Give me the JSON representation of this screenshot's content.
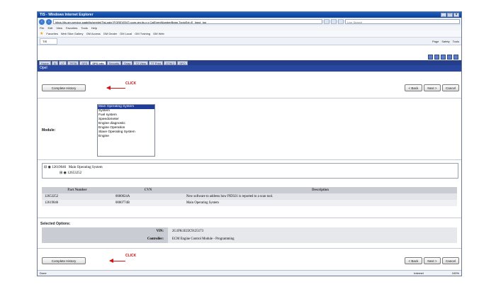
{
  "browser": {
    "title": "TIS - Windows Internet Explorer",
    "address": "https://tis.gm.service.saab/tis/servlet/TisLogin?FOREVENT=com.gm.tis.x.x.CalEventNumberBean.TopicExt=E_Input_top",
    "search_placeholder": "Live Search",
    "menu": [
      "File",
      "Edit",
      "View",
      "Favorites",
      "Tools",
      "Help"
    ],
    "favorites_label": "Favorites",
    "favorites_links": [
      "Web Slice Gallery",
      "GM Access",
      "GM Dealer",
      "GM Local",
      "GM Training",
      "GM Web"
    ],
    "tab_label": "TIS",
    "tools": [
      "Page",
      "Safety",
      "Tools"
    ],
    "status_left": "Done",
    "status_zone": "Internet",
    "zoom": "100%"
  },
  "app": {
    "nav_tabs": [
      "Home",
      "SI",
      "LT",
      "TRTB",
      "SPS",
      "SPS Info",
      "Security",
      "Snap",
      "T2 View",
      "TT Print",
      "GTM 2",
      "SPO"
    ],
    "active_tab": "SPS Info",
    "vehicle": "Opel",
    "complete_history_label": "Complete History",
    "click_label": "CLICK",
    "back_label": "< Back",
    "next_label": "Next >",
    "cancel_label": "Cancel",
    "module_label": "Module:",
    "modules": [
      "Main Operating System",
      "System",
      "Fuel system",
      "Speedometer",
      "Engine diagnostic",
      "Engine Operation",
      "Slave Operating System",
      "Engine"
    ],
    "selected_module": "Main Operating System",
    "tree": {
      "root_number": "12619046",
      "root_label": "Main Operating System",
      "child_number": "12653252"
    },
    "table": {
      "headers": [
        "Part Number",
        "CVN",
        "Description"
      ],
      "rows": [
        [
          "12653252",
          "0000024A",
          "New software to address how PID321 is reported to a scan tool."
        ],
        [
          "12619046",
          "0000774B",
          "Main Operating System"
        ]
      ]
    },
    "selected_options_label": "Selected Options:",
    "options": [
      {
        "key": "VIN:",
        "value": "2G1FK1EJ2C9125173"
      },
      {
        "key": "Controller:",
        "value": "ECM Engine Control Module - Programming"
      }
    ]
  }
}
